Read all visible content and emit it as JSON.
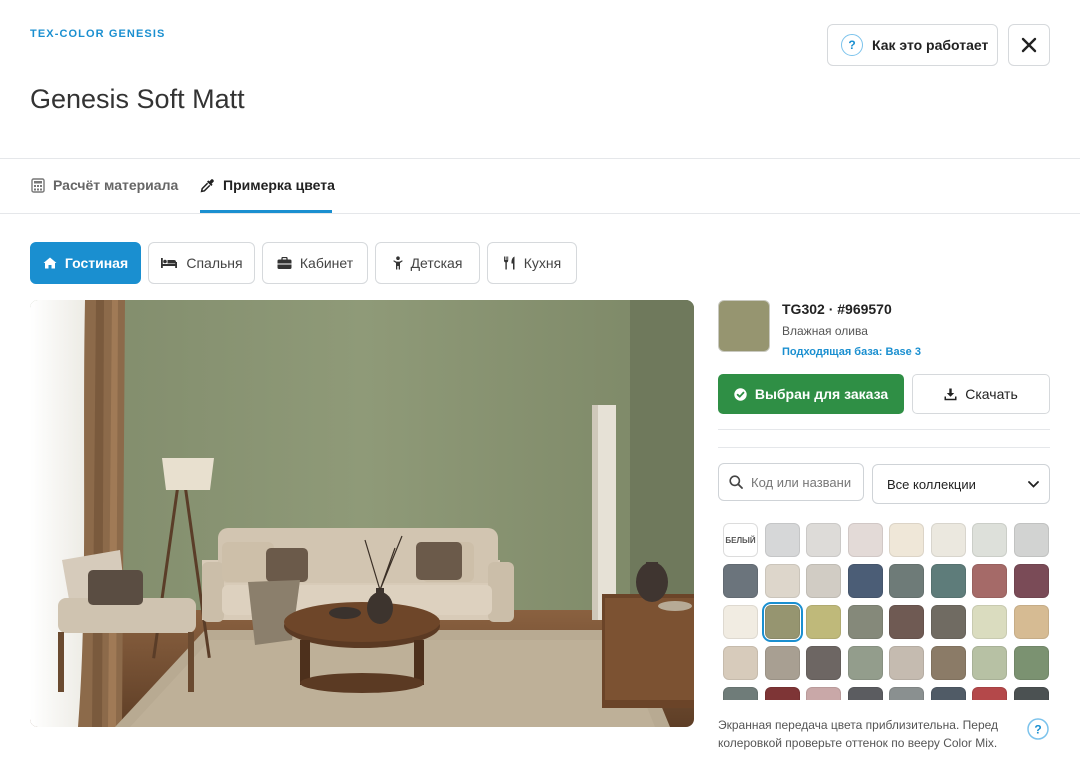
{
  "header": {
    "brand": "TEX-COLOR GENESIS",
    "title": "Genesis Soft Matt",
    "how_it_works": "Как это работает",
    "help_glyph": "?"
  },
  "main_tabs": [
    {
      "label": "Расчёт материала",
      "icon": "calculator-icon",
      "active": false
    },
    {
      "label": "Примерка цвета",
      "icon": "eyedropper-icon",
      "active": true
    }
  ],
  "rooms": [
    {
      "label": "Гостиная",
      "icon": "home-icon",
      "active": true
    },
    {
      "label": "Спальня",
      "icon": "bed-icon",
      "active": false
    },
    {
      "label": "Кабинет",
      "icon": "briefcase-icon",
      "active": false
    },
    {
      "label": "Детская",
      "icon": "child-icon",
      "active": false
    },
    {
      "label": "Кухня",
      "icon": "utensils-icon",
      "active": false
    }
  ],
  "selected_color": {
    "code_line": "TG302 · #969570",
    "hex": "#969570",
    "name": "Влажная олива",
    "base_link": "Подходящая база: Base 3"
  },
  "actions": {
    "order_label": "Выбран для заказа",
    "download_label": "Скачать"
  },
  "filters": {
    "search_placeholder": "Код или название",
    "collection_selected": "Все коллекции"
  },
  "palette": {
    "white_label": "БЕЛЫЙ",
    "rows": [
      [
        "white",
        "#d6d7d8",
        "#dddbd8",
        "#e3dad7",
        "#efe7d8",
        "#ebe8df",
        "#dde0da",
        "#d2d3d2"
      ],
      [
        "#6b747c",
        "#ddd6cb",
        "#d1ccc4",
        "#4b5d76",
        "#6e7b78",
        "#5e7c7a",
        "#a56a68",
        "#7a4b57"
      ],
      [
        "#f1ece2",
        "#969570",
        "#bfb97a",
        "#85897a",
        "#6f5a53",
        "#706b62",
        "#dadcbf",
        "#d6bb93"
      ],
      [
        "#d7cbbb",
        "#a89f92",
        "#6d6663",
        "#939d8c",
        "#c5bbb0",
        "#8b7b67",
        "#b7c1a4",
        "#7b9271"
      ],
      [
        "#6f7c79",
        "#7e3536",
        "#c9a8a8",
        "#5b5c60",
        "#8a9090",
        "#505b66",
        "#b4484a",
        "#4b5152"
      ]
    ],
    "selected_index": "2-1"
  },
  "footer": {
    "disclaimer": "Экранная передача цвета приблизительна. Перед колеровкой проверьте оттенок по вееру Color Mix.",
    "help_glyph": "?"
  }
}
